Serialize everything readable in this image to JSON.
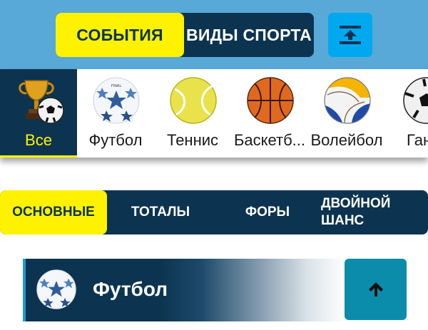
{
  "top_switch": {
    "events_label": "СОБЫТИЯ",
    "sports_label": "ВИДЫ СПОРТА"
  },
  "sports": [
    {
      "label": "Все",
      "icon": "trophy-ball-icon",
      "active": true
    },
    {
      "label": "Футбол",
      "icon": "football-icon"
    },
    {
      "label": "Теннис",
      "icon": "tennis-ball-icon"
    },
    {
      "label": "Баскетб...",
      "icon": "basketball-icon"
    },
    {
      "label": "Волейбол",
      "icon": "volleyball-icon"
    },
    {
      "label": "Ганд",
      "icon": "handball-icon"
    }
  ],
  "market_tabs": [
    {
      "label": "ОСНОВНЫЕ",
      "active": true
    },
    {
      "label": "ТОТАЛЫ"
    },
    {
      "label": "ФОРЫ"
    },
    {
      "label": "ДВОЙНОЙ ШАНС"
    }
  ],
  "league": {
    "title": "Футбол"
  },
  "colors": {
    "accent_yellow": "#fff200",
    "navy": "#0c3450",
    "sky": "#58a9d7",
    "cyan": "#00a8f0",
    "teal": "#0b8cab"
  }
}
